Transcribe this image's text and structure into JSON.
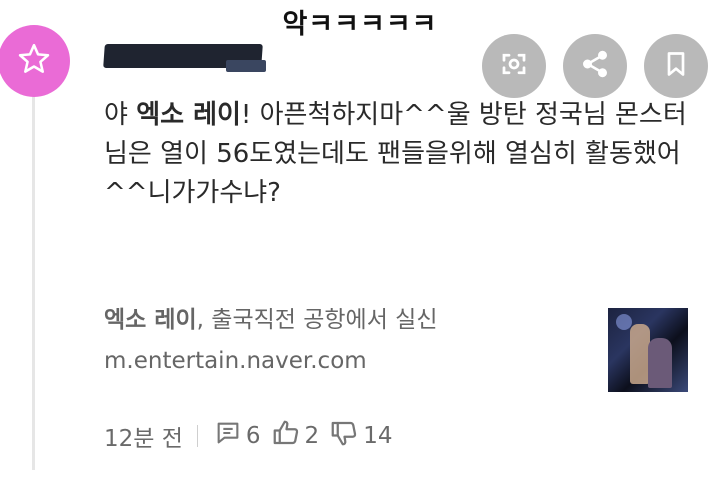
{
  "caption": "악ㅋㅋㅋㅋㅋ",
  "comment": {
    "prefix": "야 ",
    "bold_name": "엑소 레이",
    "text": "! 아픈척하지마^^울 방탄 정국님 몬스터님은 열이 56도였는데도 팬들을위해 열심히 활동했어^^니가가수냐?"
  },
  "link_card": {
    "title_bold": "엑소 레이",
    "title_rest": ", 출국직전 공항에서 실신",
    "url": "m.entertain.naver.com"
  },
  "footer": {
    "time": "12분 전",
    "replies": "6",
    "likes": "2",
    "dislikes": "14"
  },
  "icons": {
    "avatar": "star-icon",
    "action_1": "screenshot-search-icon",
    "action_2": "share-icon",
    "action_3": "bookmark-icon"
  },
  "colors": {
    "avatar_bg": "#ea6bd6",
    "action_bg": "#b9b9b9"
  }
}
